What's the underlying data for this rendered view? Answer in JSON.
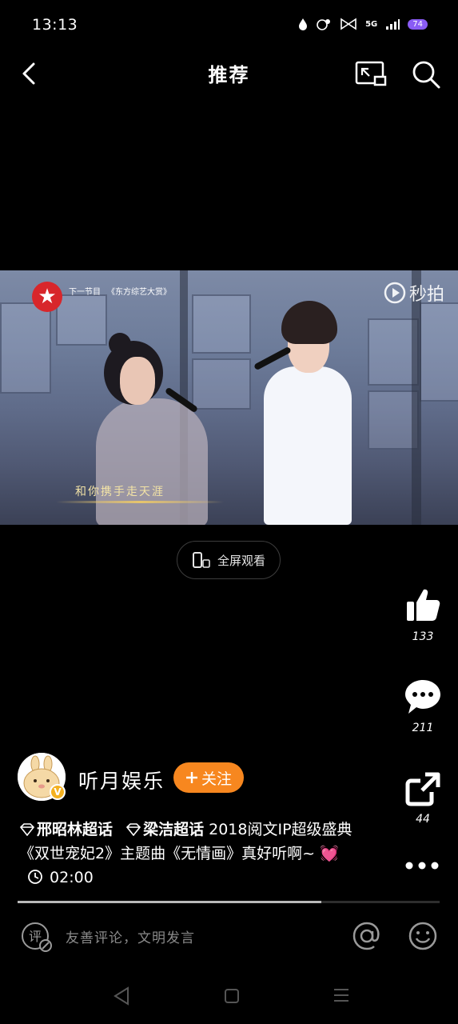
{
  "status_bar": {
    "time": "13:13",
    "network": "5G",
    "battery": "74"
  },
  "nav": {
    "title": "推荐"
  },
  "video": {
    "next_label": "下一节目",
    "next_show": "《东方综艺大赏》",
    "watermark": "秒拍",
    "subtitle": "和你携手走天涯"
  },
  "fullscreen": {
    "label": "全屏观看"
  },
  "actions": {
    "like_count": "133",
    "comment_count": "211",
    "share_count": "44"
  },
  "author": {
    "name": "听月娱乐",
    "follow_label": "关注"
  },
  "description": {
    "topic1": "邢昭林超话",
    "topic2": "梁洁超话",
    "text": " 2018阅文IP超级盛典《双世宠妃2》主题曲《无情画》真好听啊~",
    "duration": "02:00"
  },
  "playback": {
    "progress": 0.72
  },
  "comment_bar": {
    "placeholder": "友善评论，文明发言"
  }
}
